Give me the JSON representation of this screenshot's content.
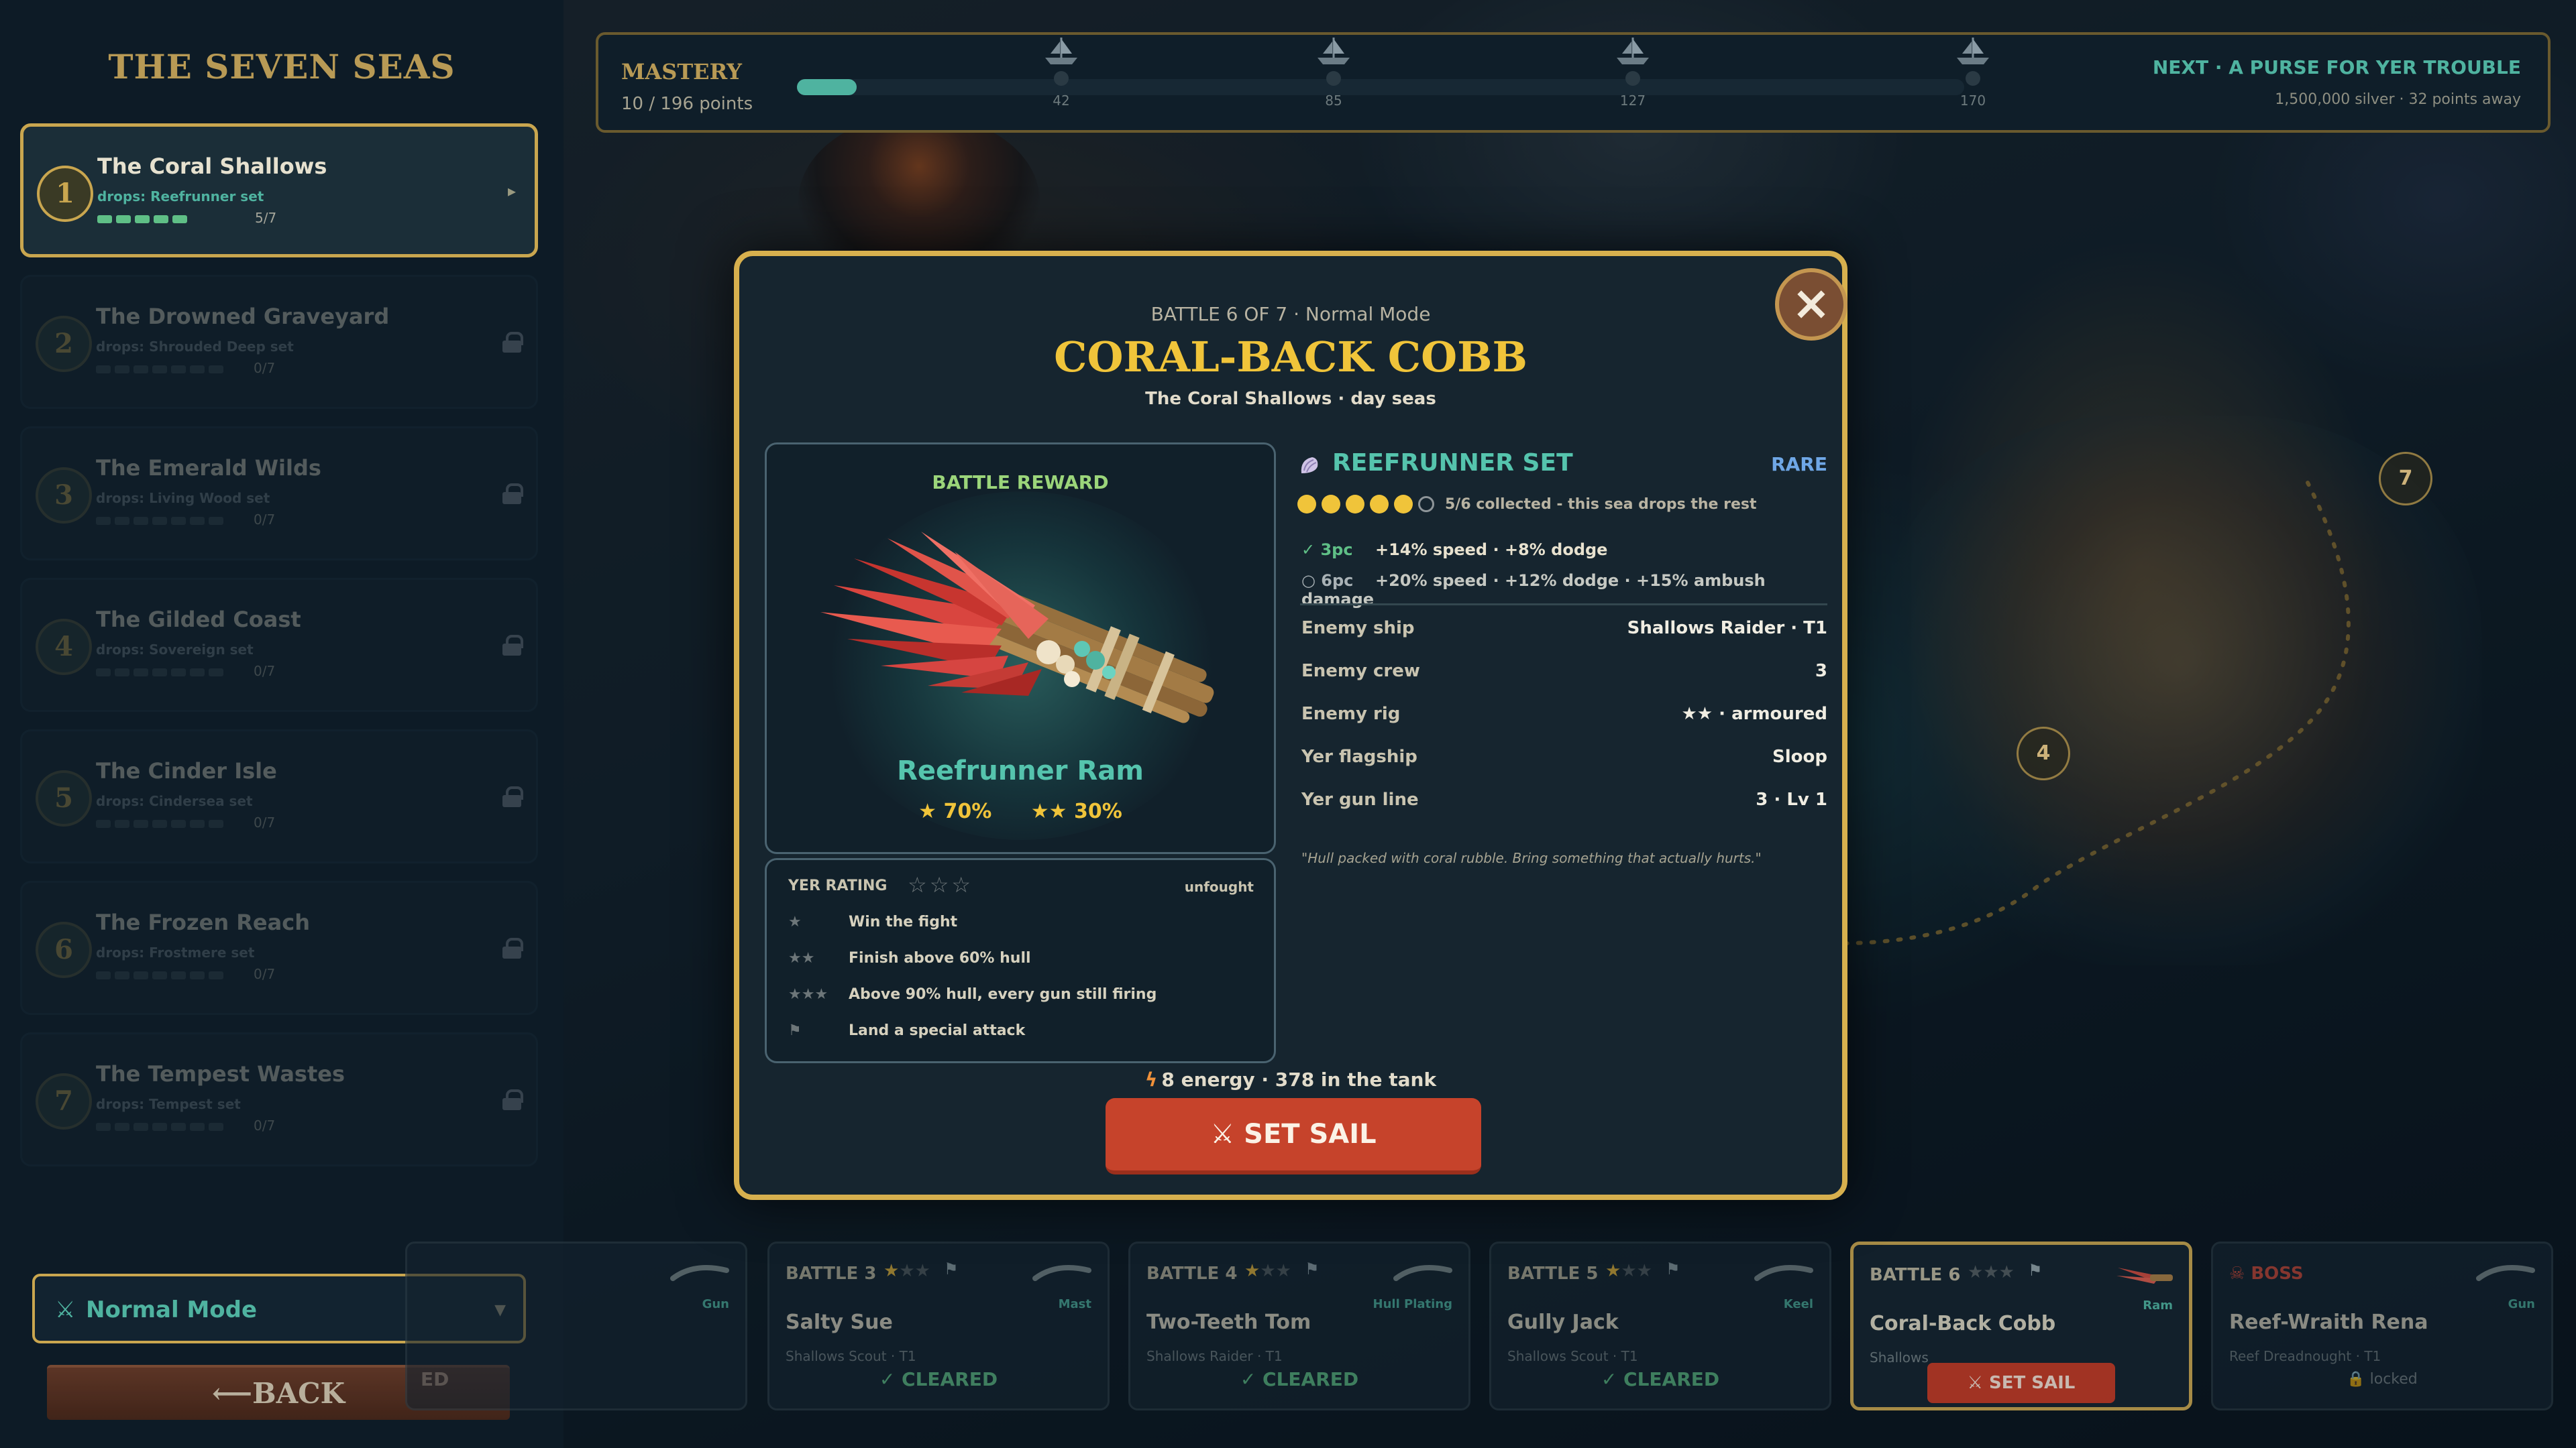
{
  "colors": {
    "gold": "#d7b04e",
    "teal": "#4fb3a0",
    "danger": "#c6432b",
    "star": "#f0c43a",
    "rare": "#6fa7e6"
  },
  "sidebar": {
    "title": "THE SEVEN SEAS",
    "seas": [
      {
        "num": "1",
        "name": "The Coral Shallows",
        "drops": "drops: Reefrunner set",
        "progress": "5/7",
        "cleared": 5,
        "state": "active"
      },
      {
        "num": "2",
        "name": "The Drowned Graveyard",
        "drops": "drops: Shrouded Deep set",
        "progress": "0/7",
        "cleared": 0,
        "state": "locked"
      },
      {
        "num": "3",
        "name": "The Emerald Wilds",
        "drops": "drops: Living Wood set",
        "progress": "0/7",
        "cleared": 0,
        "state": "locked"
      },
      {
        "num": "4",
        "name": "The Gilded Coast",
        "drops": "drops: Sovereign set",
        "progress": "0/7",
        "cleared": 0,
        "state": "locked"
      },
      {
        "num": "5",
        "name": "The Cinder Isle",
        "drops": "drops: Cindersea set",
        "progress": "0/7",
        "cleared": 0,
        "state": "locked"
      },
      {
        "num": "6",
        "name": "The Frozen Reach",
        "drops": "drops: Frostmere set",
        "progress": "0/7",
        "cleared": 0,
        "state": "locked"
      },
      {
        "num": "7",
        "name": "The Tempest Wastes",
        "drops": "drops: Tempest set",
        "progress": "0/7",
        "cleared": 0,
        "state": "locked"
      }
    ],
    "mode": {
      "icon": "crossed-swords-icon",
      "label": "Normal Mode"
    },
    "back_label": "BACK",
    "back_icon": "arrow-left-icon"
  },
  "mastery": {
    "title": "MASTERY",
    "points": "10 / 196 points",
    "progress_fraction": 0.051,
    "milestones": [
      {
        "value": "42",
        "icon": "ship-icon"
      },
      {
        "value": "85",
        "icon": "ship-icon"
      },
      {
        "value": "127",
        "icon": "ship-icon"
      },
      {
        "value": "170",
        "icon": "ship-icon"
      }
    ],
    "next": "NEXT · A PURSE FOR YER TROUBLE",
    "next_sub": "1,500,000 silver · 32 points away"
  },
  "map_nodes": [
    "4",
    "7"
  ],
  "modal": {
    "battle_sub": "BATTLE 6 OF 7 · Normal Mode",
    "enemy_name": "CORAL-BACK COBB",
    "location": "The Coral Shallows · day seas",
    "reward": {
      "label": "BATTLE REWARD",
      "item": "Reefrunner Ram",
      "rate_one": "70%",
      "rate_two": "30%",
      "rate_one_stars": "★",
      "rate_two_stars": "★★"
    },
    "rating": {
      "head": "YER RATING",
      "stars": "☆☆☆",
      "state": "unfought",
      "conditions": [
        {
          "icon": "★",
          "text": "Win the fight"
        },
        {
          "icon": "★★",
          "text": "Finish above 60% hull"
        },
        {
          "icon": "★★★",
          "text": "Above 90% hull, every gun still firing"
        },
        {
          "icon": "⚑",
          "text": "Land a special attack"
        }
      ]
    },
    "set": {
      "icon": "shell-icon",
      "name": "REEFRUNNER SET",
      "rarity": "RARE",
      "collected": 5,
      "total": 6,
      "progress_text": "5/6 collected - this sea drops the rest",
      "bonuses": [
        {
          "tier": "✓ 3pc",
          "desc": "+14% speed · +8% dodge",
          "active": true
        },
        {
          "tier": "○ 6pc",
          "desc": "+20% speed · +12% dodge · +15% ambush damage",
          "active": false
        }
      ]
    },
    "stats": [
      {
        "label": "Enemy ship",
        "value": "Shallows Raider · T1"
      },
      {
        "label": "Enemy crew",
        "value": "3"
      },
      {
        "label": "Enemy rig",
        "value": "★★ · armoured"
      },
      {
        "label": "Yer flagship",
        "value": "Sloop"
      },
      {
        "label": "Yer gun line",
        "value": "3 · Lv 1"
      }
    ],
    "flavor": "\"Hull packed with coral rubble. Bring something that actually hurts.\"",
    "energy": "8 energy · 378 in the tank",
    "energy_icon": "lightning-icon",
    "set_sail_label": "⚔ SET SAIL",
    "close_icon": "close-icon"
  },
  "battles": [
    {
      "num": "",
      "loot": "Gun",
      "enemy": "",
      "ship": "",
      "status": "ED",
      "stars": 0
    },
    {
      "num": "BATTLE 3",
      "loot": "Mast",
      "enemy": "Salty Sue",
      "ship": "Shallows Scout · T1",
      "status": "✓ CLEARED",
      "stars": 1
    },
    {
      "num": "BATTLE 4",
      "loot": "Hull Plating",
      "enemy": "Two-Teeth Tom",
      "ship": "Shallows Raider · T1",
      "status": "✓ CLEARED",
      "stars": 1
    },
    {
      "num": "BATTLE 5",
      "loot": "Keel",
      "enemy": "Gully Jack",
      "ship": "Shallows Scout · T1",
      "status": "✓ CLEARED",
      "stars": 1
    },
    {
      "num": "BATTLE 6",
      "loot": "Ram",
      "enemy": "Coral-Back Cobb",
      "ship": "Shallows",
      "status": "⚔ SET SAIL",
      "stars": 0
    },
    {
      "num": "☠ BOSS",
      "loot": "Gun",
      "enemy": "Reef-Wraith Rena",
      "ship": "Reef Dreadnought · T1",
      "status": "🔒 locked",
      "stars": 0
    }
  ]
}
